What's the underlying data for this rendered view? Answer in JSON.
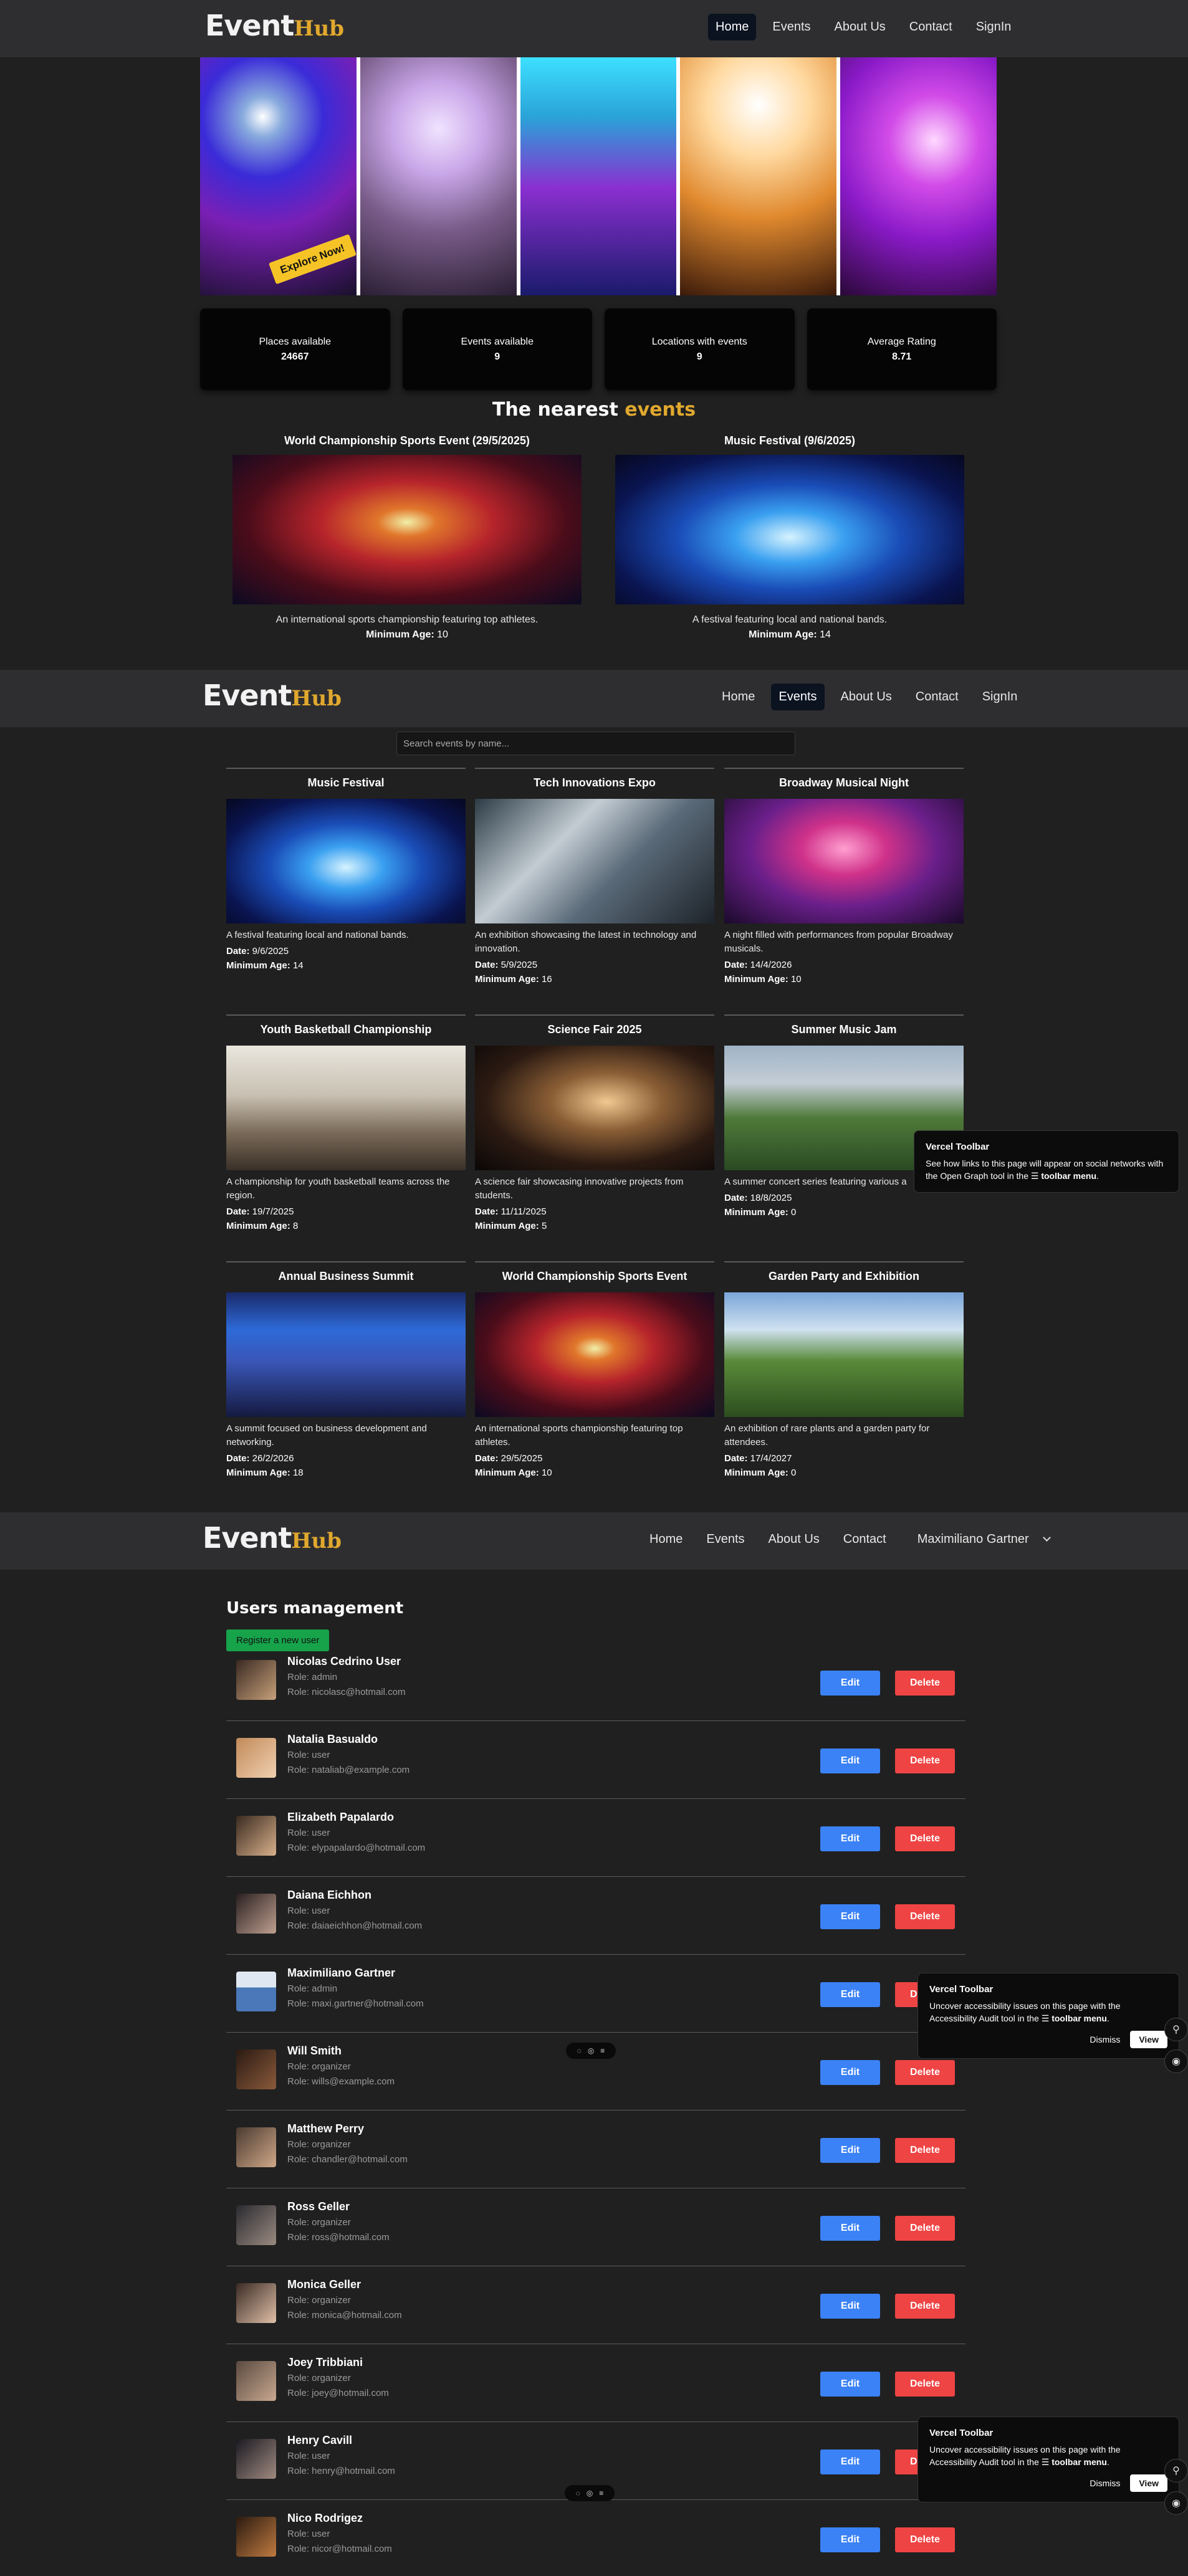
{
  "brand": {
    "event": "Event",
    "hub": "Hub"
  },
  "nav1": {
    "home": "Home",
    "events": "Events",
    "about": "About Us",
    "contact": "Contact",
    "signin": "SignIn"
  },
  "nav3": {
    "home": "Home",
    "events": "Events",
    "about": "About Us",
    "contact": "Contact",
    "user": "Maximiliano Gartner"
  },
  "hero": {
    "badge": "Explore Now!"
  },
  "stats": [
    {
      "label": "Places available",
      "value": "24667"
    },
    {
      "label": "Events available",
      "value": "9"
    },
    {
      "label": "Locations with events",
      "value": "9"
    },
    {
      "label": "Average Rating",
      "value": "8.71"
    }
  ],
  "nearest": {
    "title_a": "The nearest ",
    "title_b": "events",
    "items": [
      {
        "title": "World Championship Sports Event (29/5/2025)",
        "desc": "An international sports championship featuring top athletes.",
        "age_label": "Minimum Age:",
        "age": " 10"
      },
      {
        "title": "Music Festival (9/6/2025)",
        "desc": "A festival featuring local and national bands.",
        "age_label": "Minimum Age:",
        "age": " 14"
      }
    ]
  },
  "search": {
    "placeholder": "Search events by name..."
  },
  "labels": {
    "date": "Date:",
    "age": "Minimum Age:"
  },
  "events": [
    {
      "title": "Music Festival",
      "desc": "A festival featuring local and national bands.",
      "date": " 9/6/2025",
      "age": " 14"
    },
    {
      "title": "Tech Innovations Expo",
      "desc": "An exhibition showcasing the latest in technology and innovation.",
      "date": " 5/9/2025",
      "age": " 16"
    },
    {
      "title": "Broadway Musical Night",
      "desc": "A night filled with performances from popular Broadway musicals.",
      "date": " 14/4/2026",
      "age": " 10"
    },
    {
      "title": "Youth Basketball Championship",
      "desc": "A championship for youth basketball teams across the region.",
      "date": " 19/7/2025",
      "age": " 8"
    },
    {
      "title": "Science Fair 2025",
      "desc": "A science fair showcasing innovative projects from students.",
      "date": " 11/11/2025",
      "age": " 5"
    },
    {
      "title": "Summer Music Jam",
      "desc": "A summer concert series featuring various a",
      "date": " 18/8/2025",
      "age": " 0"
    },
    {
      "title": "Annual Business Summit",
      "desc": "A summit focused on business development and networking.",
      "date": " 26/2/2026",
      "age": " 18"
    },
    {
      "title": "World Championship Sports Event",
      "desc": "An international sports championship featuring top athletes.",
      "date": " 29/5/2025",
      "age": " 10"
    },
    {
      "title": "Garden Party and Exhibition",
      "desc": "An exhibition of rare plants and a garden party for attendees.",
      "date": " 17/4/2027",
      "age": " 0"
    }
  ],
  "users_page": {
    "title": "Users management",
    "register": "Register a new user",
    "edit": "Edit",
    "delete": "Delete"
  },
  "users": [
    {
      "name": "Nicolas Cedrino User",
      "role": "Role: admin",
      "email": "Role: nicolasc@hotmail.com"
    },
    {
      "name": "Natalia Basualdo",
      "role": "Role: user",
      "email": "Role: nataliab@example.com"
    },
    {
      "name": "Elizabeth Papalardo",
      "role": "Role: user",
      "email": "Role: elypapalardo@hotmail.com"
    },
    {
      "name": "Daiana Eichhon",
      "role": "Role: user",
      "email": "Role: daiaeichhon@hotmail.com"
    },
    {
      "name": "Maximiliano Gartner",
      "role": "Role: admin",
      "email": "Role: maxi.gartner@hotmail.com"
    },
    {
      "name": "Will Smith",
      "role": "Role: organizer",
      "email": "Role: wills@example.com"
    },
    {
      "name": "Matthew Perry",
      "role": "Role: organizer",
      "email": "Role: chandler@hotmail.com"
    },
    {
      "name": "Ross Geller",
      "role": "Role: organizer",
      "email": "Role: ross@hotmail.com"
    },
    {
      "name": "Monica Geller",
      "role": "Role: organizer",
      "email": "Role: monica@hotmail.com"
    },
    {
      "name": "Joey Tribbiani",
      "role": "Role: organizer",
      "email": "Role: joey@hotmail.com"
    },
    {
      "name": "Henry Cavill",
      "role": "Role: user",
      "email": "Role: henry@hotmail.com"
    },
    {
      "name": "Nico Rodrigez",
      "role": "Role: user",
      "email": "Role: nicor@hotmail.com"
    }
  ],
  "toast1": {
    "title": "Vercel Toolbar",
    "body_a": "See how links to this page will appear on social networks with the Open Graph tool in the ",
    "menu": "toolbar menu",
    "body_b": "."
  },
  "toast2": {
    "title": "Vercel Toolbar",
    "body_a": "Uncover accessibility issues on this page with the Accessibility Audit tool in the ",
    "menu": "toolbar menu",
    "body_b": ".",
    "dismiss": "Dismiss",
    "view": "View"
  },
  "toast3": {
    "title": "Vercel Toolbar",
    "body_a": "Uncover accessibility issues on this page with the Accessibility Audit tool in the ",
    "menu": "toolbar menu",
    "body_b": ".",
    "dismiss": "Dismiss",
    "view": "View"
  },
  "colors": {
    "accent": "#e0a82e",
    "edit": "#3b82f6",
    "delete": "#ef4444",
    "register": "#16a34a"
  }
}
